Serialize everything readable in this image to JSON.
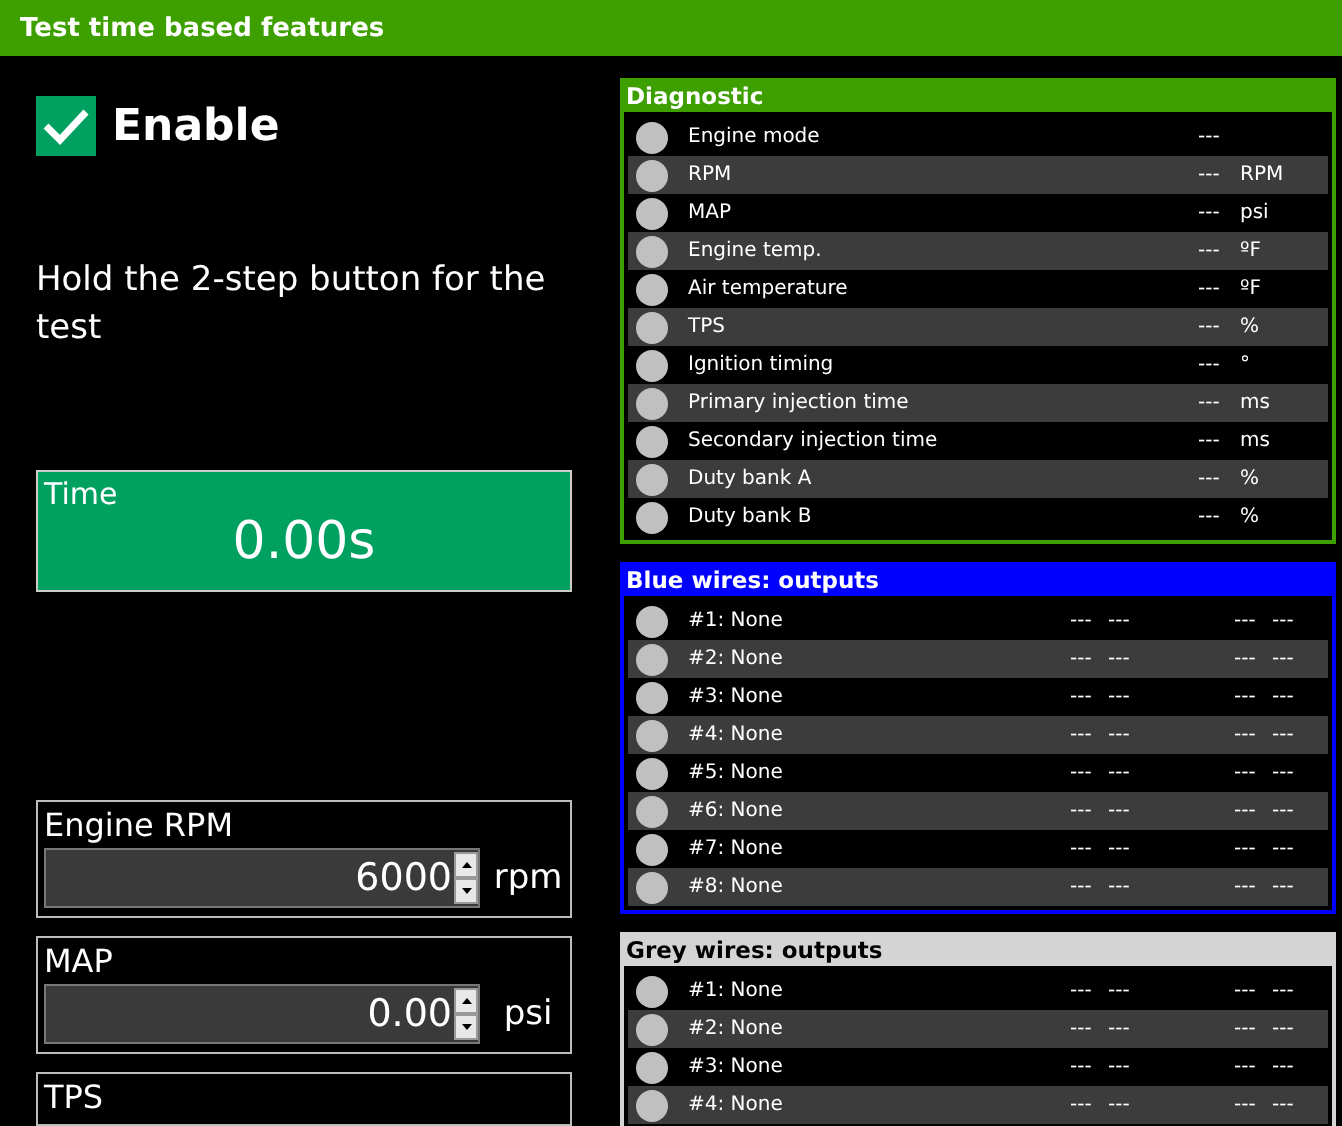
{
  "window": {
    "title": "Test time based features"
  },
  "enable": {
    "label": "Enable",
    "checked": true
  },
  "instruction": "Hold the 2-step button for the test",
  "time": {
    "label": "Time",
    "value": "0.00s"
  },
  "inputs": [
    {
      "label": "Engine RPM",
      "value": "6000",
      "unit": "rpm"
    },
    {
      "label": "MAP",
      "value": "0.00",
      "unit": "psi"
    },
    {
      "label": "TPS"
    }
  ],
  "panels": [
    {
      "title": "Diagnostic",
      "color": "#3ea000",
      "kind": "diagnostic",
      "rows": [
        {
          "label": "Engine mode",
          "on": false,
          "values": [
            "---"
          ]
        },
        {
          "label": "RPM",
          "on": false,
          "values": [
            "---",
            "RPM"
          ]
        },
        {
          "label": "MAP",
          "on": false,
          "values": [
            "---",
            "psi"
          ]
        },
        {
          "label": "Engine temp.",
          "on": false,
          "values": [
            "---",
            "ºF"
          ]
        },
        {
          "label": "Air temperature",
          "on": false,
          "values": [
            "---",
            "ºF"
          ]
        },
        {
          "label": "TPS",
          "on": false,
          "values": [
            "---",
            "%"
          ]
        },
        {
          "label": "Ignition timing",
          "on": false,
          "values": [
            "---",
            "°"
          ]
        },
        {
          "label": "Primary injection time",
          "on": false,
          "values": [
            "---",
            "ms"
          ]
        },
        {
          "label": "Secondary injection time",
          "on": false,
          "values": [
            "---",
            "ms"
          ]
        },
        {
          "label": "Duty bank A",
          "on": false,
          "values": [
            "---",
            "%"
          ]
        },
        {
          "label": "Duty bank B",
          "on": false,
          "values": [
            "---",
            "%"
          ]
        }
      ]
    },
    {
      "title": "Blue wires: outputs",
      "color": "#0000ff",
      "kind": "outputs",
      "rows": [
        {
          "label": "#1: None",
          "on": false,
          "values": [
            "---",
            "---",
            "---",
            "---"
          ]
        },
        {
          "label": "#2: None",
          "on": false,
          "values": [
            "---",
            "---",
            "---",
            "---"
          ]
        },
        {
          "label": "#3: None",
          "on": false,
          "values": [
            "---",
            "---",
            "---",
            "---"
          ]
        },
        {
          "label": "#4: None",
          "on": false,
          "values": [
            "---",
            "---",
            "---",
            "---"
          ]
        },
        {
          "label": "#5: None",
          "on": false,
          "values": [
            "---",
            "---",
            "---",
            "---"
          ]
        },
        {
          "label": "#6: None",
          "on": false,
          "values": [
            "---",
            "---",
            "---",
            "---"
          ]
        },
        {
          "label": "#7: None",
          "on": false,
          "values": [
            "---",
            "---",
            "---",
            "---"
          ]
        },
        {
          "label": "#8: None",
          "on": false,
          "values": [
            "---",
            "---",
            "---",
            "---"
          ]
        }
      ]
    },
    {
      "title": "Grey wires: outputs",
      "color": "#d4d4d4",
      "kind": "outputs",
      "rows": [
        {
          "label": "#1: None",
          "on": false,
          "values": [
            "---",
            "---",
            "---",
            "---"
          ]
        },
        {
          "label": "#2: None",
          "on": false,
          "values": [
            "---",
            "---",
            "---",
            "---"
          ]
        },
        {
          "label": "#3: None",
          "on": false,
          "values": [
            "---",
            "---",
            "---",
            "---"
          ]
        },
        {
          "label": "#4: None",
          "on": false,
          "values": [
            "---",
            "---",
            "---",
            "---"
          ]
        }
      ]
    }
  ]
}
